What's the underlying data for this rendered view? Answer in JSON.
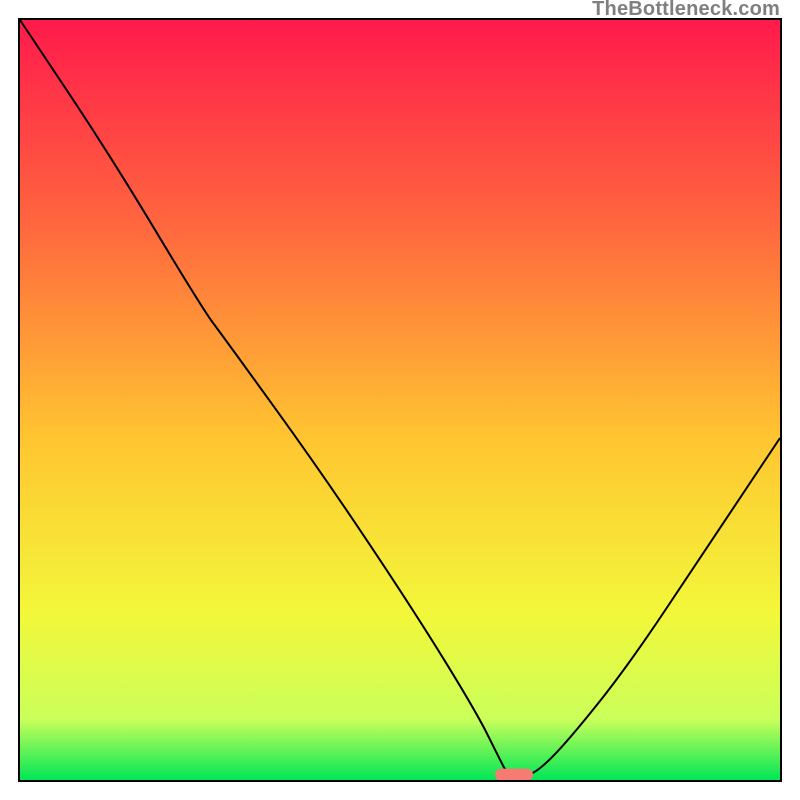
{
  "watermark": "TheBottleneck.com",
  "chart_data": {
    "type": "line",
    "title": "",
    "xlabel": "",
    "ylabel": "",
    "xlim": [
      0,
      100
    ],
    "ylim": [
      0,
      100
    ],
    "x": [
      0,
      12,
      24,
      27,
      40,
      52,
      60,
      63,
      64,
      65,
      66,
      68,
      72,
      80,
      90,
      100
    ],
    "values": [
      100,
      82,
      62,
      58,
      40,
      22,
      9,
      3,
      1,
      0.5,
      0.5,
      1,
      5,
      15,
      30,
      45
    ],
    "optimum_marker": {
      "x": 65,
      "y": 0.5,
      "color": "#f77b72"
    },
    "gradient_stops": [
      {
        "pct": 0,
        "color": "#ff1a4b"
      },
      {
        "pct": 28,
        "color": "#ff6a3e"
      },
      {
        "pct": 55,
        "color": "#ffc531"
      },
      {
        "pct": 78,
        "color": "#f3f73a"
      },
      {
        "pct": 92,
        "color": "#caff5a"
      },
      {
        "pct": 100,
        "color": "#00e756"
      }
    ]
  }
}
